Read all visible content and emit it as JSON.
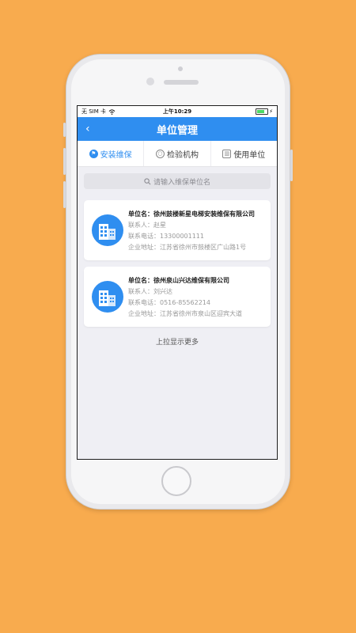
{
  "statusbar": {
    "carrier": "无 SIM 卡",
    "time": "上午10:29"
  },
  "navbar": {
    "title": "单位管理",
    "back": "‹"
  },
  "tabs": [
    {
      "label": "安装维保",
      "icon": "wrench-icon",
      "glyph": "⚑"
    },
    {
      "label": "检验机构",
      "icon": "inspect-icon",
      "glyph": "○"
    },
    {
      "label": "使用单位",
      "icon": "building-icon",
      "glyph": "▥"
    }
  ],
  "search": {
    "placeholder": "请输入维保单位名"
  },
  "cards": [
    {
      "name": "单位名：徐州鼓楼新星电梯安装维保有限公司",
      "contact": "联系人：赵星",
      "phone": "联系电话：13300001111",
      "address": "企业地址：江苏省徐州市鼓楼区广山路1号"
    },
    {
      "name": "单位名：徐州泉山兴达维保有限公司",
      "contact": "联系人：刘兴达",
      "phone": "联系电话：0516-85562214",
      "address": "企业地址：江苏省徐州市泉山区迎宾大道"
    }
  ],
  "footer": {
    "more": "上拉显示更多"
  },
  "colors": {
    "background": "#F8AB4E",
    "accent": "#2f8ef0"
  }
}
